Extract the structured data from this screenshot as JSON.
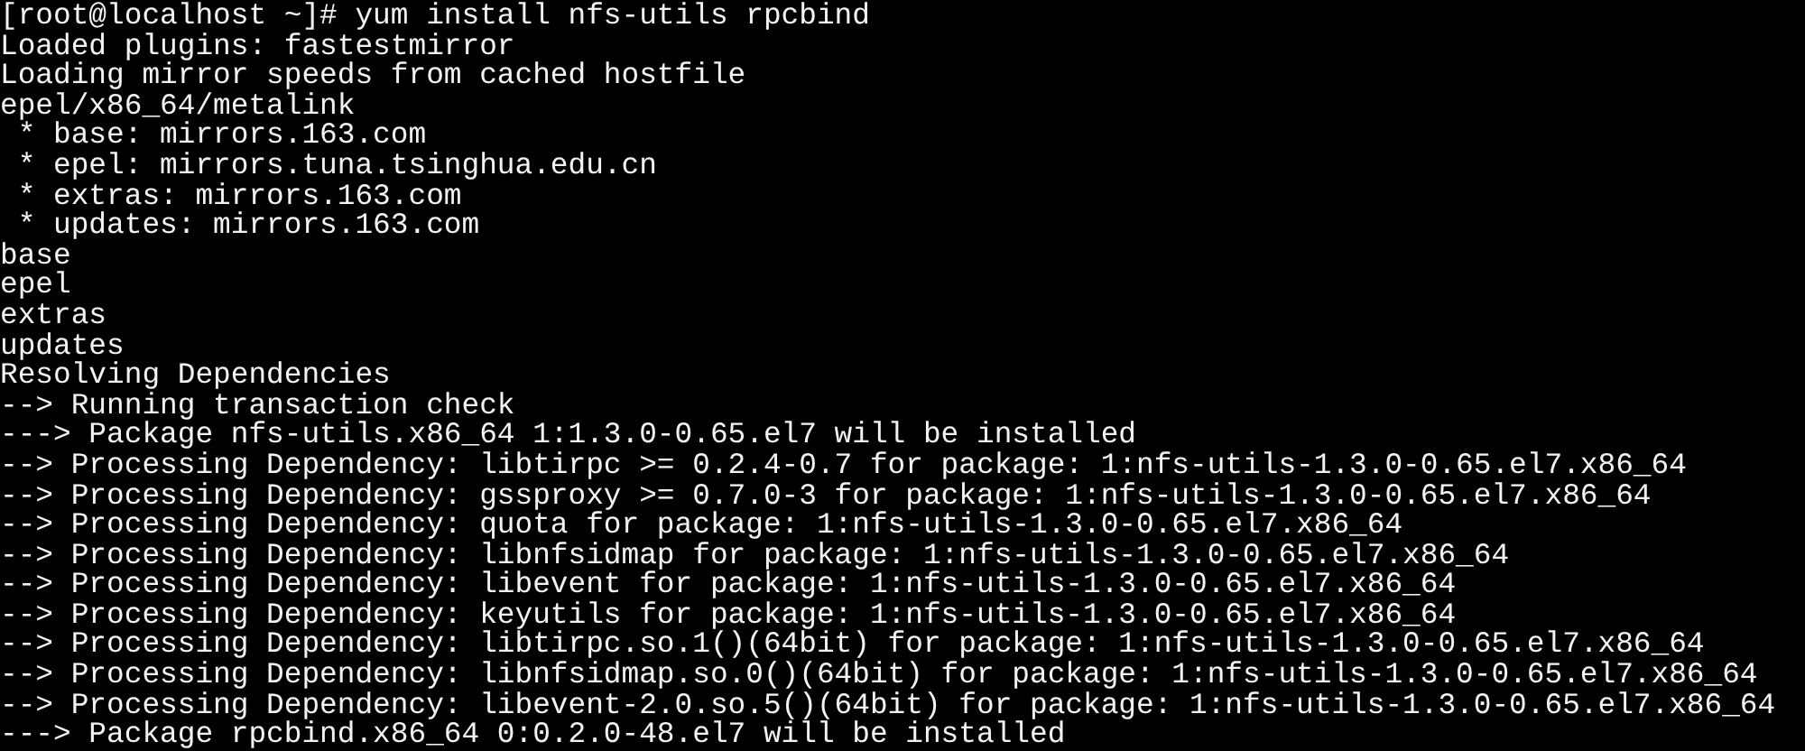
{
  "terminal": {
    "lines": [
      "[root@localhost ~]# yum install nfs-utils rpcbind",
      "Loaded plugins: fastestmirror",
      "Loading mirror speeds from cached hostfile",
      "epel/x86_64/metalink",
      " * base: mirrors.163.com",
      " * epel: mirrors.tuna.tsinghua.edu.cn",
      " * extras: mirrors.163.com",
      " * updates: mirrors.163.com",
      "base",
      "epel",
      "extras",
      "updates",
      "Resolving Dependencies",
      "--> Running transaction check",
      "---> Package nfs-utils.x86_64 1:1.3.0-0.65.el7 will be installed",
      "--> Processing Dependency: libtirpc >= 0.2.4-0.7 for package: 1:nfs-utils-1.3.0-0.65.el7.x86_64",
      "--> Processing Dependency: gssproxy >= 0.7.0-3 for package: 1:nfs-utils-1.3.0-0.65.el7.x86_64",
      "--> Processing Dependency: quota for package: 1:nfs-utils-1.3.0-0.65.el7.x86_64",
      "--> Processing Dependency: libnfsidmap for package: 1:nfs-utils-1.3.0-0.65.el7.x86_64",
      "--> Processing Dependency: libevent for package: 1:nfs-utils-1.3.0-0.65.el7.x86_64",
      "--> Processing Dependency: keyutils for package: 1:nfs-utils-1.3.0-0.65.el7.x86_64",
      "--> Processing Dependency: libtirpc.so.1()(64bit) for package: 1:nfs-utils-1.3.0-0.65.el7.x86_64",
      "--> Processing Dependency: libnfsidmap.so.0()(64bit) for package: 1:nfs-utils-1.3.0-0.65.el7.x86_64",
      "--> Processing Dependency: libevent-2.0.so.5()(64bit) for package: 1:nfs-utils-1.3.0-0.65.el7.x86_64",
      "---> Package rpcbind.x86_64 0:0.2.0-48.el7 will be installed"
    ]
  }
}
